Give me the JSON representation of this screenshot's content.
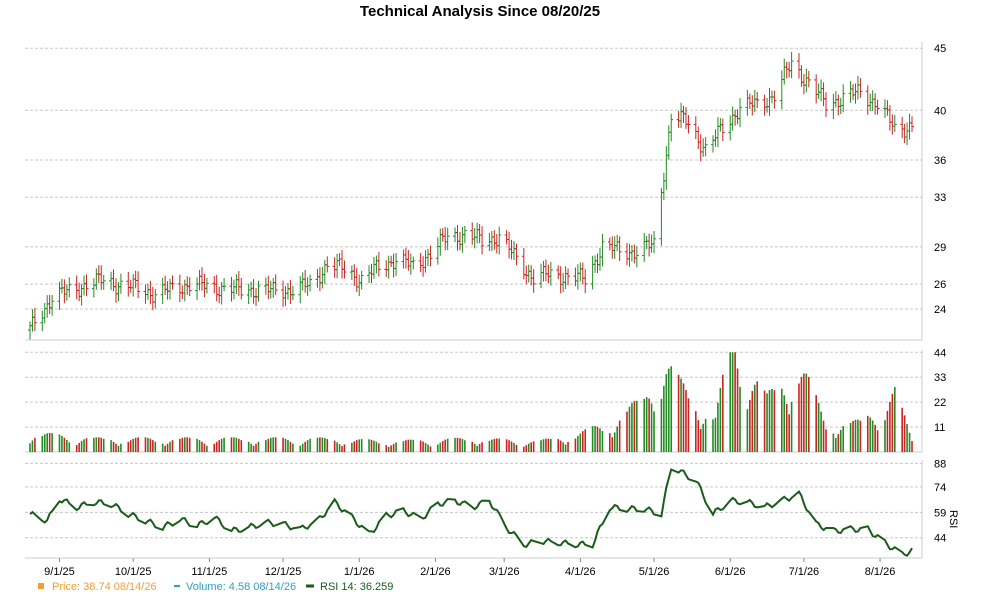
{
  "chart_data": {
    "type": "ohlc",
    "title": "Technical Analysis Since 08/20/25",
    "x_tick_labels": [
      "9/1/25",
      "10/1/25",
      "11/1/25",
      "12/1/25",
      "1/1/26",
      "2/1/26",
      "3/1/26",
      "4/1/26",
      "5/1/26",
      "6/1/26",
      "7/1/26",
      "8/1/26"
    ],
    "date_range": [
      "2025-08-20",
      "2026-08-14"
    ],
    "price_panel": {
      "y_ticks": [
        24,
        26,
        29,
        33,
        36,
        40,
        45
      ],
      "ylim": [
        21.5,
        45.5
      ],
      "grid": true,
      "up_color": "#228b22",
      "down_color": "#cc2222",
      "series_approx": [
        {
          "date": "2025-08-20",
          "close": 22.3
        },
        {
          "date": "2025-08-25",
          "close": 23.8
        },
        {
          "date": "2025-08-29",
          "close": 25.0
        },
        {
          "date": "2025-09-05",
          "close": 25.4
        },
        {
          "date": "2025-09-12",
          "close": 26.0
        },
        {
          "date": "2025-09-19",
          "close": 26.3
        },
        {
          "date": "2025-09-26",
          "close": 25.9
        },
        {
          "date": "2025-10-03",
          "close": 25.7
        },
        {
          "date": "2025-10-10",
          "close": 25.2
        },
        {
          "date": "2025-10-17",
          "close": 25.6
        },
        {
          "date": "2025-10-24",
          "close": 26.0
        },
        {
          "date": "2025-10-31",
          "close": 25.8
        },
        {
          "date": "2025-11-07",
          "close": 25.7
        },
        {
          "date": "2025-11-14",
          "close": 25.5
        },
        {
          "date": "2025-11-21",
          "close": 25.6
        },
        {
          "date": "2025-11-28",
          "close": 25.4
        },
        {
          "date": "2025-12-05",
          "close": 25.6
        },
        {
          "date": "2025-12-12",
          "close": 25.9
        },
        {
          "date": "2025-12-19",
          "close": 27.6
        },
        {
          "date": "2025-12-26",
          "close": 27.2
        },
        {
          "date": "2026-01-02",
          "close": 26.3
        },
        {
          "date": "2026-01-09",
          "close": 27.4
        },
        {
          "date": "2026-01-16",
          "close": 28.0
        },
        {
          "date": "2026-01-23",
          "close": 27.4
        },
        {
          "date": "2026-01-30",
          "close": 28.5
        },
        {
          "date": "2026-02-06",
          "close": 29.8
        },
        {
          "date": "2026-02-13",
          "close": 30.0
        },
        {
          "date": "2026-02-20",
          "close": 29.5
        },
        {
          "date": "2026-02-27",
          "close": 29.8
        },
        {
          "date": "2026-03-06",
          "close": 28.0
        },
        {
          "date": "2026-03-13",
          "close": 26.5
        },
        {
          "date": "2026-03-20",
          "close": 26.8
        },
        {
          "date": "2026-03-27",
          "close": 26.6
        },
        {
          "date": "2026-04-03",
          "close": 26.4
        },
        {
          "date": "2026-04-10",
          "close": 29.0
        },
        {
          "date": "2026-04-17",
          "close": 28.7
        },
        {
          "date": "2026-04-24",
          "close": 28.6
        },
        {
          "date": "2026-05-01",
          "close": 29.2
        },
        {
          "date": "2026-05-08",
          "close": 39.5
        },
        {
          "date": "2026-05-15",
          "close": 39.0
        },
        {
          "date": "2026-05-22",
          "close": 36.8
        },
        {
          "date": "2026-05-29",
          "close": 38.6
        },
        {
          "date": "2026-06-05",
          "close": 40.2
        },
        {
          "date": "2026-06-12",
          "close": 40.5
        },
        {
          "date": "2026-06-19",
          "close": 41.2
        },
        {
          "date": "2026-06-26",
          "close": 43.8
        },
        {
          "date": "2026-07-03",
          "close": 42.2
        },
        {
          "date": "2026-07-10",
          "close": 40.5
        },
        {
          "date": "2026-07-17",
          "close": 41.0
        },
        {
          "date": "2026-07-24",
          "close": 41.5
        },
        {
          "date": "2026-07-31",
          "close": 40.5
        },
        {
          "date": "2026-08-07",
          "close": 38.5
        },
        {
          "date": "2026-08-14",
          "close": 38.74
        }
      ]
    },
    "volume_panel": {
      "y_ticks": [
        11,
        22,
        33,
        44
      ],
      "ylim": [
        0,
        45
      ],
      "grid": true,
      "series_approx": [
        {
          "date": "2025-08-22",
          "value": 7
        },
        {
          "date": "2025-09-15",
          "value": 5
        },
        {
          "date": "2025-10-15",
          "value": 5
        },
        {
          "date": "2025-11-15",
          "value": 5
        },
        {
          "date": "2025-12-15",
          "value": 5
        },
        {
          "date": "2026-01-15",
          "value": 4
        },
        {
          "date": "2026-02-15",
          "value": 5
        },
        {
          "date": "2026-03-15",
          "value": 4
        },
        {
          "date": "2026-04-01",
          "value": 7
        },
        {
          "date": "2026-04-15",
          "value": 12
        },
        {
          "date": "2026-04-27",
          "value": 20
        },
        {
          "date": "2026-05-01",
          "value": 32
        },
        {
          "date": "2026-05-06",
          "value": 33
        },
        {
          "date": "2026-05-12",
          "value": 25
        },
        {
          "date": "2026-05-26",
          "value": 13
        },
        {
          "date": "2026-06-02",
          "value": 44
        },
        {
          "date": "2026-06-16",
          "value": 20
        },
        {
          "date": "2026-06-29",
          "value": 34
        },
        {
          "date": "2026-07-10",
          "value": 11
        },
        {
          "date": "2026-07-24",
          "value": 11
        },
        {
          "date": "2026-08-07",
          "value": 23
        },
        {
          "date": "2026-08-14",
          "value": 4.58
        }
      ]
    },
    "rsi_panel": {
      "label": "RSI",
      "y_ticks": [
        44,
        59,
        74,
        88
      ],
      "ylim": [
        32,
        90
      ],
      "grid": true,
      "series_approx": [
        {
          "date": "2025-08-20",
          "value": 58
        },
        {
          "date": "2025-08-27",
          "value": 54
        },
        {
          "date": "2025-09-01",
          "value": 67
        },
        {
          "date": "2025-09-08",
          "value": 62
        },
        {
          "date": "2025-09-15",
          "value": 65
        },
        {
          "date": "2025-09-22",
          "value": 64
        },
        {
          "date": "2025-09-29",
          "value": 58
        },
        {
          "date": "2025-10-06",
          "value": 54
        },
        {
          "date": "2025-10-13",
          "value": 50
        },
        {
          "date": "2025-10-20",
          "value": 55
        },
        {
          "date": "2025-10-27",
          "value": 51
        },
        {
          "date": "2025-11-03",
          "value": 56
        },
        {
          "date": "2025-11-10",
          "value": 48
        },
        {
          "date": "2025-11-17",
          "value": 50
        },
        {
          "date": "2025-11-24",
          "value": 53
        },
        {
          "date": "2025-12-01",
          "value": 52
        },
        {
          "date": "2025-12-08",
          "value": 49
        },
        {
          "date": "2025-12-15",
          "value": 54
        },
        {
          "date": "2025-12-22",
          "value": 65
        },
        {
          "date": "2025-12-29",
          "value": 56
        },
        {
          "date": "2026-01-05",
          "value": 46
        },
        {
          "date": "2026-01-12",
          "value": 57
        },
        {
          "date": "2026-01-19",
          "value": 60
        },
        {
          "date": "2026-01-26",
          "value": 55
        },
        {
          "date": "2026-02-02",
          "value": 64
        },
        {
          "date": "2026-02-09",
          "value": 66
        },
        {
          "date": "2026-02-16",
          "value": 62
        },
        {
          "date": "2026-02-23",
          "value": 66
        },
        {
          "date": "2026-03-02",
          "value": 50
        },
        {
          "date": "2026-03-09",
          "value": 40
        },
        {
          "date": "2026-03-16",
          "value": 42
        },
        {
          "date": "2026-03-23",
          "value": 41
        },
        {
          "date": "2026-03-30",
          "value": 40
        },
        {
          "date": "2026-04-06",
          "value": 40
        },
        {
          "date": "2026-04-13",
          "value": 62
        },
        {
          "date": "2026-04-20",
          "value": 61
        },
        {
          "date": "2026-04-27",
          "value": 61
        },
        {
          "date": "2026-05-04",
          "value": 58
        },
        {
          "date": "2026-05-08",
          "value": 86
        },
        {
          "date": "2026-05-18",
          "value": 78
        },
        {
          "date": "2026-05-25",
          "value": 58
        },
        {
          "date": "2026-06-01",
          "value": 66
        },
        {
          "date": "2026-06-08",
          "value": 65
        },
        {
          "date": "2026-06-15",
          "value": 62
        },
        {
          "date": "2026-06-22",
          "value": 66
        },
        {
          "date": "2026-06-29",
          "value": 70
        },
        {
          "date": "2026-07-06",
          "value": 52
        },
        {
          "date": "2026-07-13",
          "value": 48
        },
        {
          "date": "2026-07-20",
          "value": 49
        },
        {
          "date": "2026-07-27",
          "value": 49
        },
        {
          "date": "2026-08-03",
          "value": 41
        },
        {
          "date": "2026-08-10",
          "value": 34
        },
        {
          "date": "2026-08-14",
          "value": 36.259
        }
      ]
    },
    "legend": {
      "price": {
        "label": "Price: 38.74  08/14/26",
        "color": "#f0a030"
      },
      "volume": {
        "label": "Volume: 4.58  08/14/26",
        "color": "#30a0c0"
      },
      "rsi": {
        "label": "RSI 14: 36.259",
        "color": "#1a5c1a"
      }
    }
  }
}
